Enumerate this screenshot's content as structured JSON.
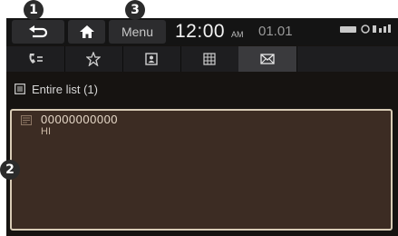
{
  "topbar": {
    "menu_label": "Menu",
    "time": "12:00",
    "ampm": "AM",
    "date": "01.01",
    "back_icon": "back-arrow-icon",
    "home_icon": "home-icon"
  },
  "tabs": [
    {
      "icon": "phone-recents-icon",
      "active": false
    },
    {
      "icon": "star-icon",
      "active": false
    },
    {
      "icon": "contacts-icon",
      "active": false
    },
    {
      "icon": "dialpad-icon",
      "active": false
    },
    {
      "icon": "envelope-icon",
      "active": true
    }
  ],
  "list": {
    "header": "Entire list (1)",
    "items": [
      {
        "number": "00000000000",
        "preview": "HI"
      }
    ]
  },
  "callouts": [
    "1",
    "2",
    "3"
  ],
  "colors": {
    "background": "#161311",
    "message_area": "#3c2c23",
    "highlight_border": "#d8cbb5"
  }
}
